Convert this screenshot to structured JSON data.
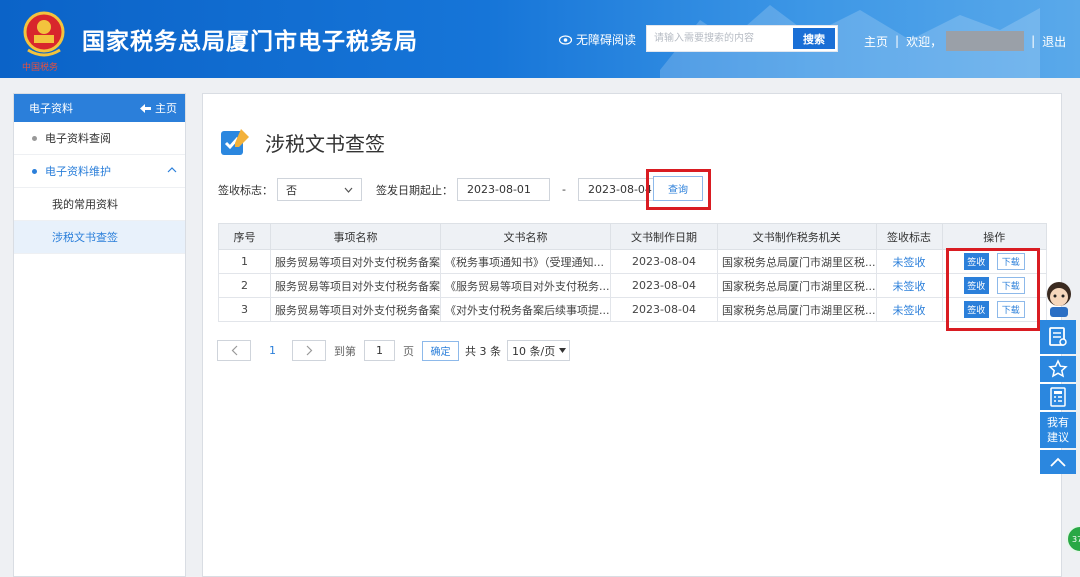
{
  "header": {
    "emblem_text": "中国税务",
    "site_title": "国家税务总局厦门市电子税务局",
    "accessibility_label": "无障碍阅读",
    "search_placeholder": "请输入需要搜索的内容",
    "search_button": "搜索",
    "nav_home": "主页",
    "nav_sep": "|",
    "welcome": "欢迎，",
    "logout": "退出"
  },
  "sidebar": {
    "title": "电子资料",
    "home": "主页",
    "items": [
      {
        "label": "电子资料查阅"
      },
      {
        "label": "电子资料维护"
      }
    ],
    "subitems": [
      {
        "label": "我的常用资料"
      },
      {
        "label": "涉税文书查签"
      }
    ]
  },
  "page": {
    "title": "涉税文书查签"
  },
  "filters": {
    "sign_flag_label": "签收标志：",
    "sign_flag_value": "否",
    "date_range_label": "签发日期起止：",
    "date_from": "2023-08-01",
    "date_dash": "-",
    "date_to": "2023-08-04",
    "query_button": "查询"
  },
  "table": {
    "columns": [
      "序号",
      "事项名称",
      "文书名称",
      "文书制作日期",
      "文书制作税务机关",
      "签收标志",
      "操作"
    ],
    "rows": [
      {
        "no": "1",
        "item": "服务贸易等项目对外支付税务备案",
        "doc": "《税务事项通知书》（受理通知...",
        "date": "2023-08-04",
        "org": "国家税务总局厦门市湖里区税...",
        "flag": "未签收"
      },
      {
        "no": "2",
        "item": "服务贸易等项目对外支付税务备案",
        "doc": "《服务贸易等项目对外支付税务...",
        "date": "2023-08-04",
        "org": "国家税务总局厦门市湖里区税...",
        "flag": "未签收"
      },
      {
        "no": "3",
        "item": "服务贸易等项目对外支付税务备案",
        "doc": "《对外支付税务备案后续事项提...",
        "date": "2023-08-04",
        "org": "国家税务总局厦门市湖里区税...",
        "flag": "未签收"
      }
    ],
    "sign_button": "签收",
    "download_button": "下载"
  },
  "pagination": {
    "current_page": "1",
    "goto_label": "到第",
    "goto_value": "1",
    "page_unit": "页",
    "confirm": "确定",
    "total": "共 3 条",
    "page_size": "10 条/页"
  },
  "floating": {
    "suggest": "我有建议",
    "badge": "37"
  },
  "colors": {
    "brand_blue": "#1a6fd6",
    "accent_blue": "#2b7fda",
    "highlight_red": "#d91c22"
  }
}
